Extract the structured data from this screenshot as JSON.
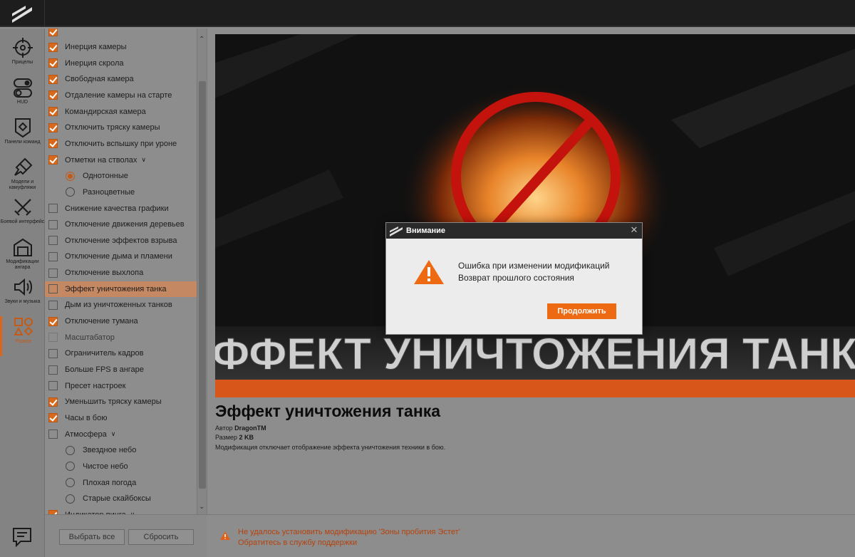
{
  "rail": {
    "items": [
      {
        "label": "Прицелы",
        "icon": "crosshair-icon"
      },
      {
        "label": "HUD",
        "icon": "toggles-icon"
      },
      {
        "label": "Панели команд",
        "icon": "panel-badge-icon"
      },
      {
        "label": "Модели и камуфляжи",
        "icon": "paint-brush-icon"
      },
      {
        "label": "Боевой интерфейс",
        "icon": "crossed-swords-icon"
      },
      {
        "label": "Модификации ангара",
        "icon": "hangar-icon"
      },
      {
        "label": "Звуки и музыка",
        "icon": "speaker-icon"
      },
      {
        "label": "Разное",
        "icon": "shapes-icon"
      }
    ]
  },
  "list": {
    "items": [
      {
        "label": "Инерция камеры",
        "kind": "check",
        "on": true
      },
      {
        "label": "Инерция скрола",
        "kind": "check",
        "on": true
      },
      {
        "label": "Свободная камера",
        "kind": "check",
        "on": true
      },
      {
        "label": "Отдаление камеры на старте",
        "kind": "check",
        "on": true
      },
      {
        "label": "Командирская камера",
        "kind": "check",
        "on": true
      },
      {
        "label": "Отключить тряску камеры",
        "kind": "check",
        "on": true
      },
      {
        "label": "Отключить вспышку при уроне",
        "kind": "check",
        "on": true
      },
      {
        "label": "Отметки на стволах",
        "kind": "check",
        "on": true,
        "expand": true
      },
      {
        "label": "Однотонные",
        "kind": "radio",
        "on": true
      },
      {
        "label": "Разноцветные",
        "kind": "radio",
        "on": false
      },
      {
        "label": "Снижение качества графики",
        "kind": "check",
        "on": false
      },
      {
        "label": "Отключение движения деревьев",
        "kind": "check",
        "on": false
      },
      {
        "label": "Отключение эффектов взрыва",
        "kind": "check",
        "on": false
      },
      {
        "label": "Отключение дыма и пламени",
        "kind": "check",
        "on": false
      },
      {
        "label": "Отключение выхлопа",
        "kind": "check",
        "on": false
      },
      {
        "label": "Эффект уничтожения танка",
        "kind": "check",
        "on": false,
        "selected": true
      },
      {
        "label": "Дым из уничтоженных танков",
        "kind": "check",
        "on": false
      },
      {
        "label": "Отключение тумана",
        "kind": "check",
        "on": true
      },
      {
        "label": "Масштабатор",
        "kind": "check",
        "on": false,
        "disabled": true
      },
      {
        "label": "Ограничитель кадров",
        "kind": "check",
        "on": false
      },
      {
        "label": "Больше FPS в ангаре",
        "kind": "check",
        "on": false
      },
      {
        "label": "Пресет настроек",
        "kind": "check",
        "on": false
      },
      {
        "label": "Уменьшить тряску камеры",
        "kind": "check",
        "on": true
      },
      {
        "label": "Часы в бою",
        "kind": "check",
        "on": true
      },
      {
        "label": "Атмосфера",
        "kind": "check",
        "on": false,
        "expand": true
      },
      {
        "label": "Звездное небо",
        "kind": "radio",
        "on": false
      },
      {
        "label": "Чистое небо",
        "kind": "radio",
        "on": false
      },
      {
        "label": "Плохая погода",
        "kind": "radio",
        "on": false
      },
      {
        "label": "Старые скайбоксы",
        "kind": "radio",
        "on": false
      },
      {
        "label": "Индикатор пинга",
        "kind": "check",
        "on": true,
        "expand": true
      }
    ],
    "select_all_label": "Выбрать все",
    "reset_label": "Сбросить"
  },
  "detail": {
    "banner_text": "ЭФФЕКТ УНИЧТОЖЕНИЯ ТАНКА",
    "title": "Эффект уничтожения танка",
    "author_label": "Автор",
    "author_value": "DragonTM",
    "size_label": "Размер",
    "size_value": "2 KB",
    "description": "Модификация отключает отображение эффекта уничтожения техники в бою."
  },
  "footer": {
    "line1": "Не удалось установить модификацию 'Зоны пробития Эстет'",
    "line2": "Обратитесь в службу поддержки"
  },
  "modal": {
    "title": "Внимание",
    "line1": "Ошибка при изменении модификаций",
    "line2": "Возврат прошлого состояния",
    "button": "Продолжить"
  },
  "colors": {
    "accent": "#ee6a12",
    "warning_text": "#b5420d",
    "topbar": "#1d1d1d"
  }
}
